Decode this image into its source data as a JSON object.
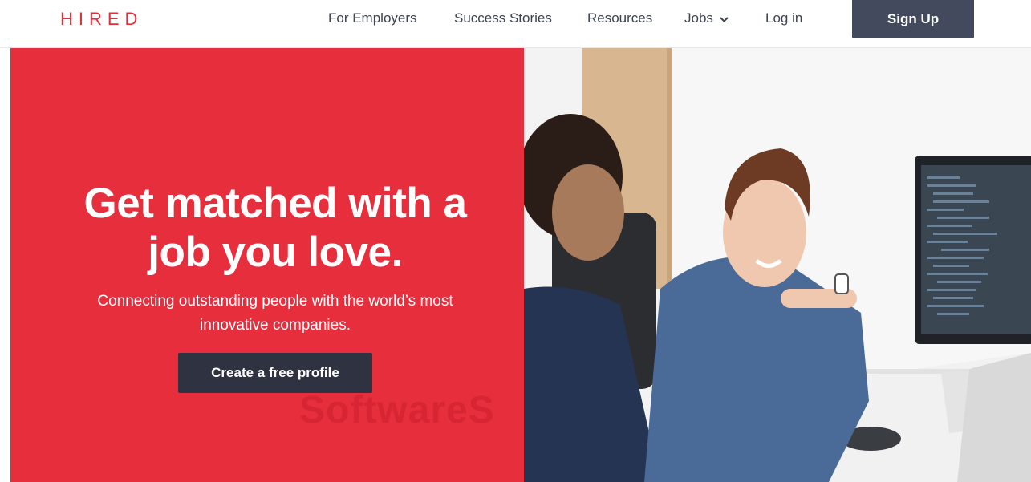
{
  "header": {
    "logo": "HIRED",
    "nav": {
      "employers": "For Employers",
      "stories": "Success Stories",
      "resources": "Resources",
      "jobs": "Jobs",
      "login": "Log in"
    },
    "signup_label": "Sign Up"
  },
  "hero": {
    "headline_line1": "Get matched with a",
    "headline_line2": "job you love.",
    "subline_line1": "Connecting outstanding people with the world’s most",
    "subline_line2": "innovative companies.",
    "cta_label": "Create a free profile",
    "watermark": "SoftwareS"
  },
  "colors": {
    "brand_red": "#e72e3c",
    "dark_button": "#2e3241",
    "signup_button": "#434a5e",
    "nav_text": "#3d4353"
  },
  "icons": {
    "jobs_dropdown": "chevron-down-icon"
  }
}
